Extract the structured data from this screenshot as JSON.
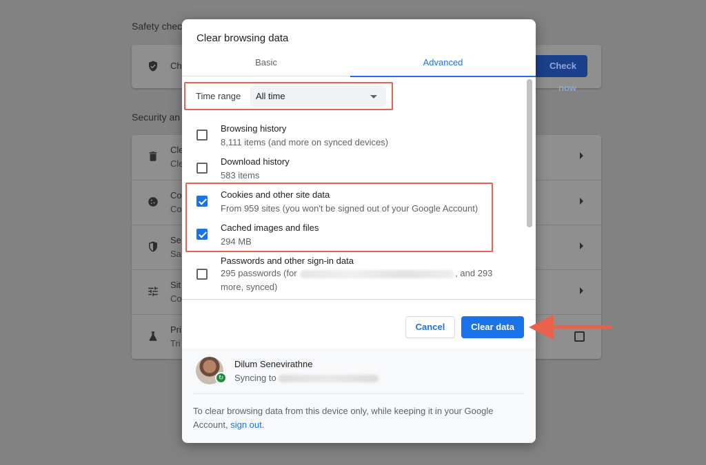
{
  "background": {
    "safety_heading": "Safety chec",
    "security_heading": "Security an",
    "check_now_label": "Check now",
    "safety_row": {
      "title": "Ch",
      "icon": "shield-check-icon"
    },
    "rows": [
      {
        "title": "Cle",
        "sub": "Cle",
        "icon": "trash-icon"
      },
      {
        "title": "Co",
        "sub": "Co",
        "icon": "cookie-icon"
      },
      {
        "title": "Se",
        "sub": "Sa",
        "icon": "shield-icon"
      },
      {
        "title": "Sit",
        "sub": "Co",
        "icon": "tune-icon"
      },
      {
        "title": "Pri",
        "sub": "Tri",
        "icon": "flask-icon"
      }
    ]
  },
  "dialog": {
    "title": "Clear browsing data",
    "tabs": [
      {
        "label": "Basic",
        "selected": false
      },
      {
        "label": "Advanced",
        "selected": true
      }
    ],
    "time_range": {
      "label": "Time range",
      "value": "All time"
    },
    "items": [
      {
        "title": "Browsing history",
        "sub": "8,111 items (and more on synced devices)",
        "checked": false
      },
      {
        "title": "Download history",
        "sub": "583 items",
        "checked": false
      },
      {
        "title": "Cookies and other site data",
        "sub": "From 959 sites (you won't be signed out of your Google Account)",
        "checked": true
      },
      {
        "title": "Cached images and files",
        "sub": "294 MB",
        "checked": true
      },
      {
        "title": "Passwords and other sign-in data",
        "sub_prefix": "295 passwords (for",
        "sub_suffix": ", and 293",
        "sub_line2": "more, synced)",
        "checked": false
      }
    ],
    "cancel_label": "Cancel",
    "clear_label": "Clear data",
    "sync": {
      "name": "Dilum Senevirathne",
      "status_prefix": "Syncing to",
      "note_text": "To clear browsing data from this device only, while keeping it in your Google Account,",
      "link_text": "sign out",
      "note_end": "."
    }
  },
  "colors": {
    "accent": "#1a73e8",
    "highlight": "#e9604b",
    "sync_badge": "#1e8e3e"
  }
}
